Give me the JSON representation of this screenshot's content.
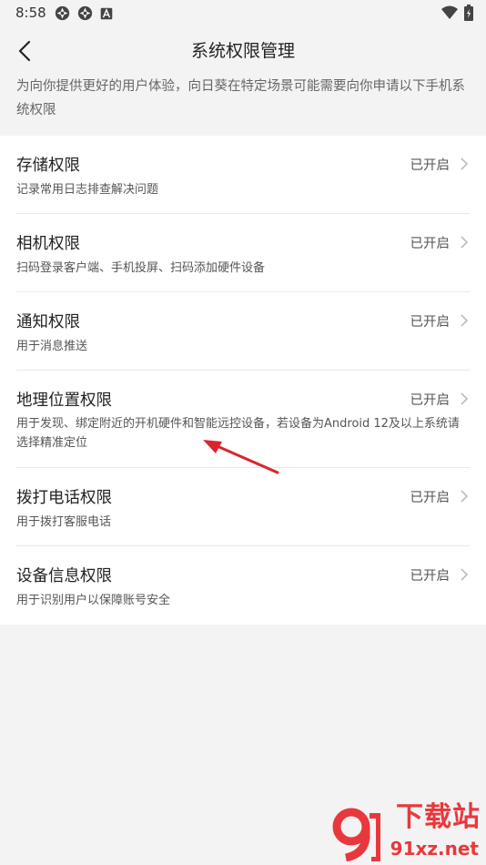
{
  "status_bar": {
    "time": "8:58"
  },
  "header": {
    "title": "系统权限管理"
  },
  "intro": "为向你提供更好的用户体验，向日葵在特定场景可能需要向你申请以下手机系统权限",
  "permissions": [
    {
      "title": "存储权限",
      "desc": "记录常用日志排查解决问题",
      "status": "已开启"
    },
    {
      "title": "相机权限",
      "desc": "扫码登录客户端、手机投屏、扫码添加硬件设备",
      "status": "已开启"
    },
    {
      "title": "通知权限",
      "desc": "用于消息推送",
      "status": "已开启"
    },
    {
      "title": "地理位置权限",
      "desc": "用于发现、绑定附近的开机硬件和智能远控设备，若设备为Android 12及以上系统请选择精准定位",
      "status": "已开启"
    },
    {
      "title": "拨打电话权限",
      "desc": "用于拨打客服电话",
      "status": "已开启"
    },
    {
      "title": "设备信息权限",
      "desc": "用于识别用户以保障账号安全",
      "status": "已开启"
    }
  ],
  "watermark": {
    "top": "下载站",
    "bottom": "91xz.net"
  },
  "colors": {
    "background": "#f3f3f3",
    "card": "#ffffff",
    "annotation_arrow": "#d9252a",
    "watermark": "#e8383d"
  }
}
